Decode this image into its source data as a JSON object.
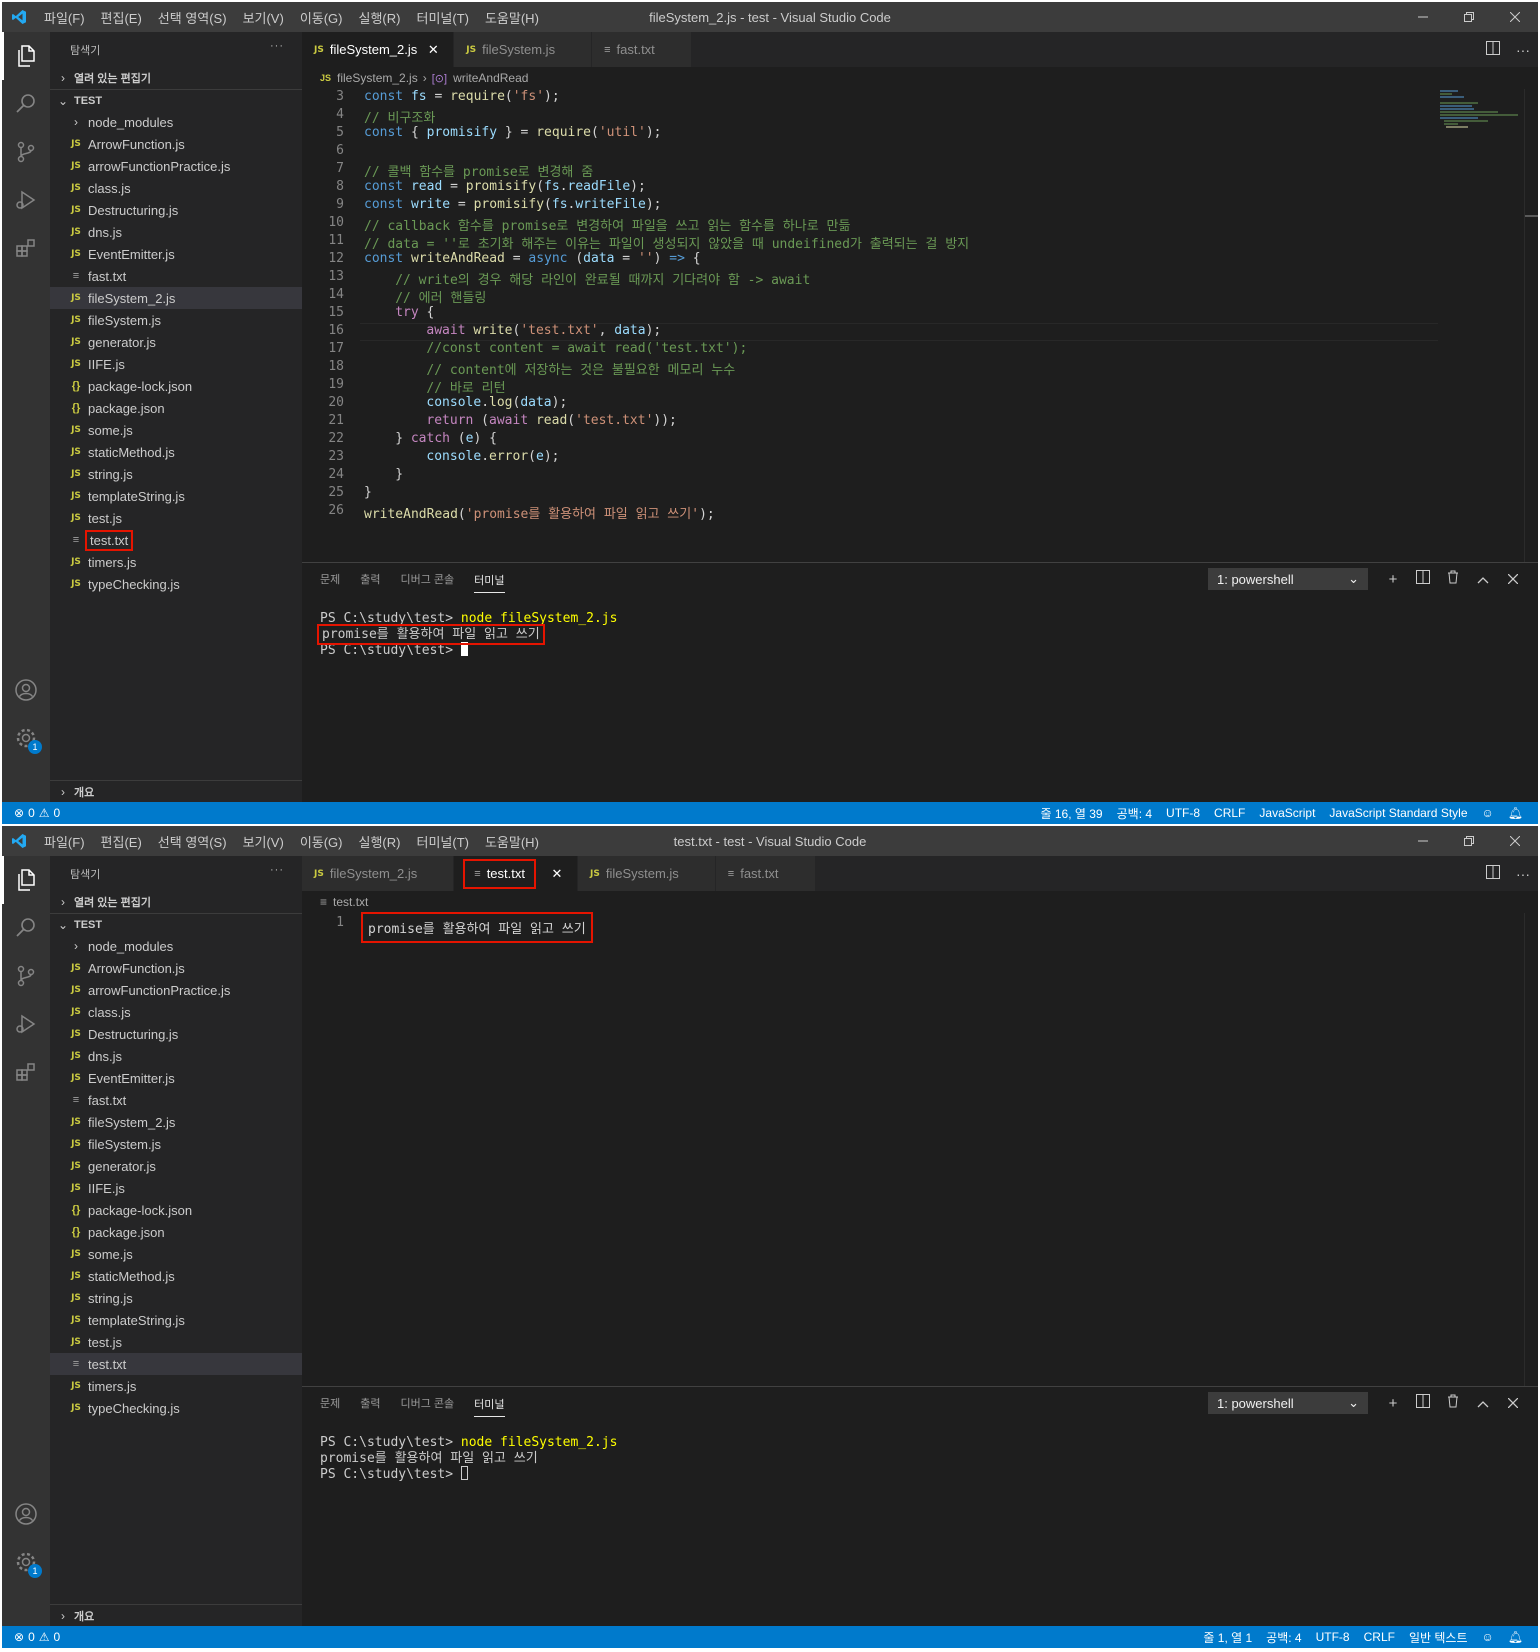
{
  "menu": [
    "파일(F)",
    "편집(E)",
    "선택 영역(S)",
    "보기(V)",
    "이동(G)",
    "실행(R)",
    "터미널(T)",
    "도움말(H)"
  ],
  "explorer_title": "탐색기",
  "open_editors": "열려 있는 편집기",
  "project": "TEST",
  "outline": "개요",
  "files": [
    {
      "name": "node_modules",
      "type": "folder"
    },
    {
      "name": "ArrowFunction.js",
      "type": "js"
    },
    {
      "name": "arrowFunctionPractice.js",
      "type": "js"
    },
    {
      "name": "class.js",
      "type": "js"
    },
    {
      "name": "Destructuring.js",
      "type": "js"
    },
    {
      "name": "dns.js",
      "type": "js"
    },
    {
      "name": "EventEmitter.js",
      "type": "js"
    },
    {
      "name": "fast.txt",
      "type": "txt"
    },
    {
      "name": "fileSystem_2.js",
      "type": "js"
    },
    {
      "name": "fileSystem.js",
      "type": "js"
    },
    {
      "name": "generator.js",
      "type": "js"
    },
    {
      "name": "IIFE.js",
      "type": "js"
    },
    {
      "name": "package-lock.json",
      "type": "json"
    },
    {
      "name": "package.json",
      "type": "json"
    },
    {
      "name": "some.js",
      "type": "js"
    },
    {
      "name": "staticMethod.js",
      "type": "js"
    },
    {
      "name": "string.js",
      "type": "js"
    },
    {
      "name": "templateString.js",
      "type": "js"
    },
    {
      "name": "test.js",
      "type": "js"
    },
    {
      "name": "test.txt",
      "type": "txt"
    },
    {
      "name": "timers.js",
      "type": "js"
    },
    {
      "name": "typeChecking.js",
      "type": "js"
    }
  ],
  "panel_tabs": [
    "문제",
    "출력",
    "디버그 콘솔",
    "터미널"
  ],
  "terminal_select": "1: powershell",
  "terminal_lines": [
    "PS C:\\study\\test> ",
    "node fileSystem_2.js",
    "promise를 활용하여 파일 읽고 쓰기",
    "PS C:\\study\\test> "
  ],
  "status_errors": "0",
  "status_warnings": "0",
  "pane_a": {
    "window_title": "fileSystem_2.js - test - Visual Studio Code",
    "tabs": [
      "fileSystem_2.js",
      "fileSystem.js",
      "fast.txt"
    ],
    "breadcrumb_file": "fileSystem_2.js",
    "breadcrumb_symbol": "writeAndRead",
    "line_numbers": [
      "3",
      "4",
      "5",
      "6",
      "7",
      "8",
      "9",
      "10",
      "11",
      "12",
      "13",
      "14",
      "15",
      "16",
      "17",
      "18",
      "19",
      "20",
      "21",
      "22",
      "23",
      "24",
      "25",
      "26"
    ],
    "code": {
      "l3a": "const ",
      "l3b": "fs",
      "l3c": " = ",
      "l3d": "require",
      "l3e": "(",
      "l3f": "'fs'",
      "l3g": ");",
      "l4": "// 비구조화",
      "l5a": "const ",
      "l5b": "{ ",
      "l5c": "promisify",
      "l5d": " } = ",
      "l5e": "require",
      "l5f": "(",
      "l5g": "'util'",
      "l5h": ");",
      "l7": "// 콜백 함수를 promise로 변경해 줌",
      "l8a": "const ",
      "l8b": "read",
      "l8c": " = ",
      "l8d": "promisify",
      "l8e": "(",
      "l8f": "fs",
      "l8g": ".",
      "l8h": "readFile",
      "l8i": ");",
      "l9a": "const ",
      "l9b": "write",
      "l9c": " = ",
      "l9d": "promisify",
      "l9e": "(",
      "l9f": "fs",
      "l9g": ".",
      "l9h": "writeFile",
      "l9i": ");",
      "l10": "// callback 함수를 promise로 변경하여 파일을 쓰고 읽는 함수를 하나로 만듦",
      "l11": "// data = ''로 초기화 해주는 이유는 파일이 생성되지 않았을 때 undeifined가 출력되는 걸 방지",
      "l12a": "const ",
      "l12b": "writeAndRead",
      "l12c": " = ",
      "l12d": "async",
      "l12e": " (",
      "l12f": "data",
      "l12g": " = ",
      "l12h": "''",
      "l12i": ") ",
      "l12j": "=>",
      "l12k": " {",
      "l13": "// write의 경우 해당 라인이 완료될 때까지 기다려야 함 -> await",
      "l14": "// 에러 핸들링",
      "l15a": "try",
      "l15b": " {",
      "l16a": "await ",
      "l16b": "write",
      "l16c": "(",
      "l16d": "'test.txt'",
      "l16e": ", ",
      "l16f": "data",
      "l16g": ");",
      "l17": "//const content = await read('test.txt');",
      "l18": "// content에 저장하는 것은 불필요한 메모리 누수",
      "l19": "// 바로 리턴",
      "l20a": "console",
      "l20b": ".",
      "l20c": "log",
      "l20d": "(",
      "l20e": "data",
      "l20f": ");",
      "l21a": "return",
      "l21b": " (",
      "l21c": "await ",
      "l21d": "read",
      "l21e": "(",
      "l21f": "'test.txt'",
      "l21g": "));",
      "l22a": "} ",
      "l22b": "catch",
      "l22c": " (",
      "l22d": "e",
      "l22e": ") {",
      "l23a": "console",
      "l23b": ".",
      "l23c": "error",
      "l23d": "(",
      "l23e": "e",
      "l23f": ");",
      "l24": "}",
      "l25": "}",
      "l26a": "writeAndRead",
      "l26b": "(",
      "l26c": "'promise를 활용하여 파일 읽고 쓰기'",
      "l26d": ");"
    },
    "status": [
      "줄 16, 열 39",
      "공백: 4",
      "UTF-8",
      "CRLF",
      "JavaScript",
      "JavaScript Standard Style"
    ]
  },
  "pane_b": {
    "window_title": "test.txt - test - Visual Studio Code",
    "tabs": [
      "fileSystem_2.js",
      "test.txt",
      "fileSystem.js",
      "fast.txt"
    ],
    "breadcrumb_file": "test.txt",
    "line_number": "1",
    "content": "promise를 활용하여 파일 읽고 쓰기",
    "status": [
      "줄 1, 열 1",
      "공백: 4",
      "UTF-8",
      "CRLF",
      "일반 텍스트"
    ]
  },
  "colors": {
    "accent": "#007acc",
    "highlight_box": "#e51400",
    "editor_bg": "#1e1e1e",
    "sidebar_bg": "#252526"
  },
  "icons": [
    "vscode-logo-icon",
    "explorer-icon",
    "search-icon",
    "source-control-icon",
    "run-debug-icon",
    "extensions-icon",
    "account-icon",
    "gear-icon",
    "split-editor-icon",
    "more-icon",
    "plus-icon",
    "trash-icon",
    "chevron-up-icon",
    "close-icon",
    "error-icon",
    "warning-icon",
    "feedback-icon",
    "bell-icon"
  ]
}
